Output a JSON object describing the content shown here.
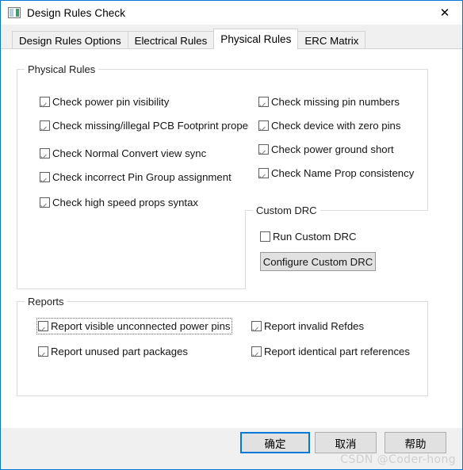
{
  "window": {
    "title": "Design Rules Check",
    "icon": "design-rules-icon",
    "close_label": "✕"
  },
  "tabs": [
    {
      "label": "Design Rules Options",
      "active": false
    },
    {
      "label": "Electrical Rules",
      "active": false
    },
    {
      "label": "Physical Rules",
      "active": true
    },
    {
      "label": "ERC Matrix",
      "active": false
    }
  ],
  "physical_rules": {
    "group_title": "Physical Rules",
    "left_column": [
      {
        "label": "Check power pin visibility",
        "checked": true,
        "mnemonic": "e"
      },
      {
        "label": "Check missing/illegal PCB Footprint property",
        "checked": true,
        "mnemonic": "P",
        "clipped": true
      },
      {
        "label": "Check Normal Convert view sync",
        "checked": true,
        "mnemonic": "N"
      },
      {
        "label": "Check incorrect Pin Group assignment",
        "checked": true,
        "mnemonic": "G"
      },
      {
        "label": "Check high speed props syntax",
        "checked": true,
        "mnemonic": "s"
      }
    ],
    "right_column": [
      {
        "label": "Check missing pin numbers",
        "checked": true,
        "mnemonic": "h"
      },
      {
        "label": "Check device with zero pins",
        "checked": true,
        "mnemonic": "d"
      },
      {
        "label": "Check power ground short",
        "checked": true,
        "mnemonic": "w"
      },
      {
        "label": "Check Name Prop consistency",
        "checked": true,
        "mnemonic": ""
      }
    ]
  },
  "custom_drc": {
    "group_title": "Custom DRC",
    "run_checkbox": {
      "label": "Run Custom DRC",
      "checked": false
    },
    "configure_button": "Configure Custom DRC"
  },
  "reports": {
    "group_title": "Reports",
    "left_column": [
      {
        "label": "Report visible unconnected power pins",
        "checked": true,
        "mnemonic": "v",
        "focused": true
      },
      {
        "label": "Report unused part packages",
        "checked": true,
        "mnemonic": "t"
      }
    ],
    "right_column": [
      {
        "label": "Report invalid Refdes",
        "checked": true,
        "mnemonic": "R"
      },
      {
        "label": "Report identical part references",
        "checked": true,
        "mnemonic": "f"
      }
    ]
  },
  "footer": {
    "ok_label": "确定",
    "cancel_label": "取消",
    "help_label": "帮助"
  },
  "watermark": "CSDN @Coder-hong",
  "colors": {
    "accent": "#0078d7",
    "dialog_bg": "#f0f0f0",
    "page_bg": "#ffffff",
    "group_border": "#dcdcdc",
    "button_face": "#e1e1e1"
  }
}
